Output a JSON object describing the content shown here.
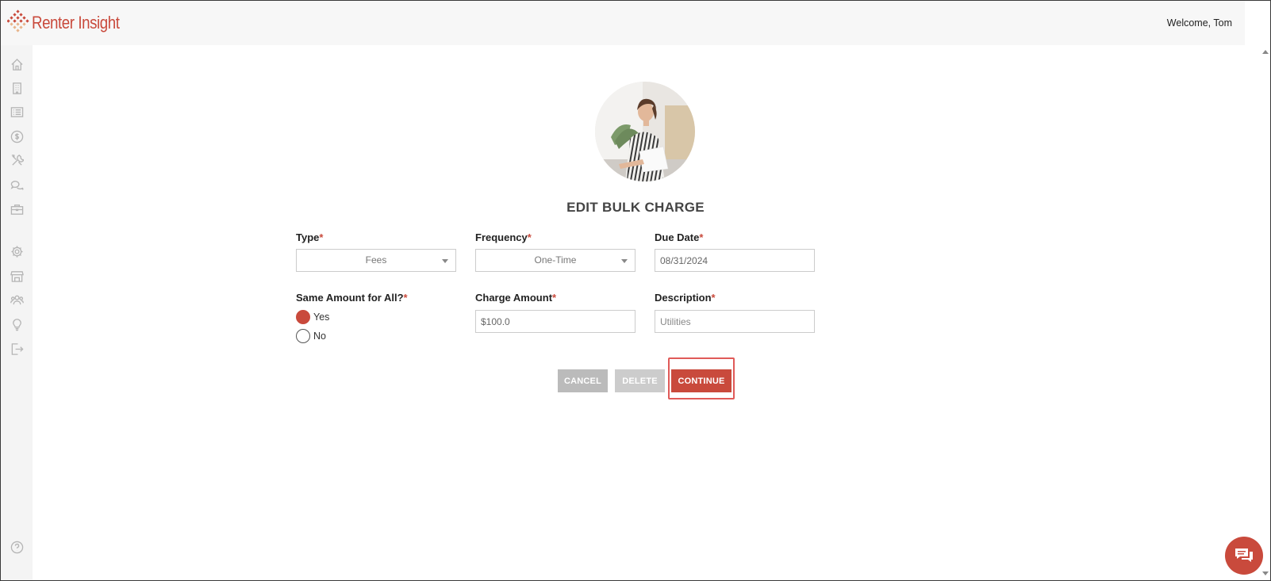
{
  "app": {
    "logo_text": "Renter Insight",
    "welcome": "Welcome, Tom"
  },
  "sidebar": {
    "items": [
      {
        "icon": "home-icon"
      },
      {
        "icon": "building-icon"
      },
      {
        "icon": "list-icon"
      },
      {
        "icon": "dollar-icon"
      },
      {
        "icon": "tools-icon"
      },
      {
        "icon": "chat-icon"
      },
      {
        "icon": "briefcase-icon"
      },
      {
        "icon": "gear-icon"
      },
      {
        "icon": "store-icon"
      },
      {
        "icon": "users-icon"
      },
      {
        "icon": "lightbulb-icon"
      },
      {
        "icon": "logout-icon"
      },
      {
        "icon": "help-icon"
      }
    ]
  },
  "form": {
    "title": "EDIT BULK CHARGE",
    "type": {
      "label": "Type",
      "required": "*",
      "value": "Fees"
    },
    "frequency": {
      "label": "Frequency",
      "required": "*",
      "value": "One-Time"
    },
    "due_date": {
      "label": "Due Date",
      "required": "*",
      "value": "08/31/2024"
    },
    "same_amount": {
      "label": "Same Amount for All?",
      "required": "*",
      "options": [
        {
          "label": "Yes",
          "checked": true
        },
        {
          "label": "No",
          "checked": false
        }
      ]
    },
    "charge_amount": {
      "label": "Charge Amount",
      "required": "*",
      "value": "$100.0"
    },
    "description": {
      "label": "Description",
      "required": "*",
      "placeholder": "Utilities"
    }
  },
  "buttons": {
    "cancel": "CANCEL",
    "delete": "DELETE",
    "continue": "CONTINUE"
  },
  "colors": {
    "accent": "#c94a3c",
    "highlight": "#e05a58"
  }
}
